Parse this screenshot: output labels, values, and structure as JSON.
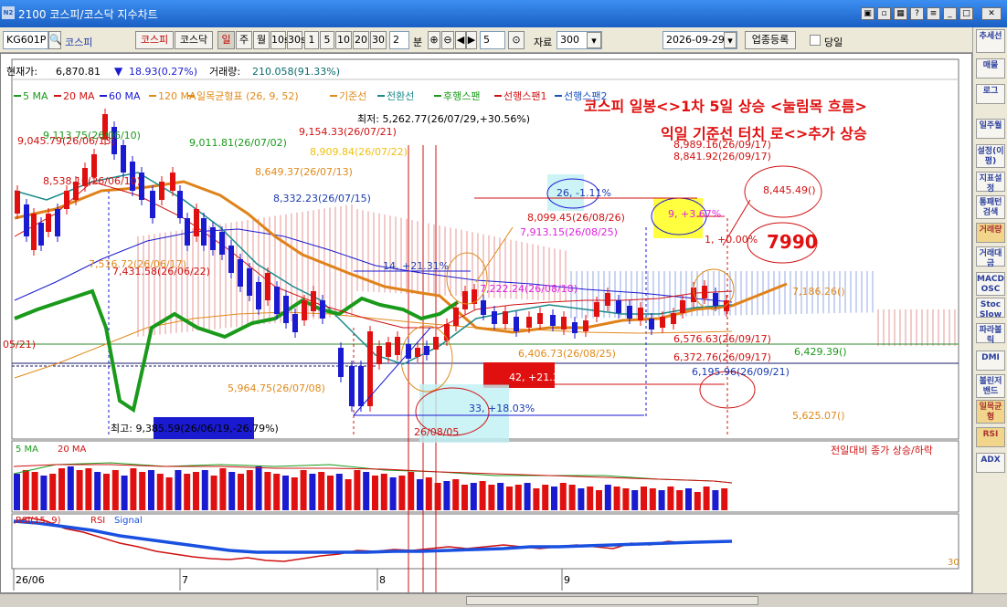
{
  "window": {
    "title": "2100 코스피/코스닥 지수차트",
    "icon_text": "N2"
  },
  "toolbar": {
    "code": "KG601P",
    "name": "코스피",
    "btn_kospi": "코스피",
    "btn_kosdaq": "코스닥",
    "periods": [
      "일",
      "주",
      "월",
      "10s",
      "30s",
      "1",
      "5",
      "10",
      "20",
      "30"
    ],
    "count_value": "2",
    "unit_label": "분",
    "span_value": "5",
    "data_label": "자료",
    "data_value": "300",
    "date_value": "2026-09-29",
    "industry_btn": "업종등록",
    "same_day_label": "당일"
  },
  "sidebar": [
    "추세선",
    "매물",
    "로그",
    "일주월",
    "설정(이평)",
    "지표설정",
    "통패턴검색",
    "거래량",
    "거래대금",
    "MACD OSC",
    "Stoc Slow",
    "파라볼릭",
    "DMI",
    "볼린저밴드",
    "일목균형",
    "RSI",
    "ADX"
  ],
  "chart": {
    "info": {
      "price_label": "현재가:",
      "price": "6,870.81",
      "change": "18.93(0.27%)",
      "vol_label": "거래량:",
      "volume": "210.058(91.33%)"
    },
    "legend": [
      {
        "label": "5 MA",
        "color": "#1a9a1a"
      },
      {
        "label": "20 MA",
        "color": "#d01010"
      },
      {
        "label": "60 MA",
        "color": "#1a1ad0"
      },
      {
        "label": "120 MA",
        "color": "#e08a1a"
      },
      {
        "label": "일목균형표 (26, 9, 52)",
        "color": "#e08a1a"
      },
      {
        "label": "기준선",
        "color": "#e08a1a"
      },
      {
        "label": "전환선",
        "color": "#1a8a8a"
      },
      {
        "label": "후행스팬",
        "color": "#1a9a1a"
      },
      {
        "label": "선행스팬1",
        "color": "#d01010"
      },
      {
        "label": "선행스팬2",
        "color": "#1a50c0"
      }
    ],
    "headline1": "코스피 일봉<>1차 5일 상승 <눌림목 흐름>",
    "headline2": "익일 기준선 터치 로<>추가 상승",
    "target": "7990",
    "annotations": [
      "9,113.75(26/06/10)",
      "9,045.79(26/06/13)",
      "8,538.10(26/06/10)",
      "9,011.81(26/07/02)",
      "9,154.33(26/07/21)",
      "최저: 5,262.77(26/07/29,+30.56%)",
      "8,909.84(26/07/22)",
      "8,649.37(26/07/13)",
      "8,332.23(26/07/15)",
      "26, -1.11%",
      "8,989.16(26/09/17)",
      "8,841.92(26/09/17)",
      "8,445.49()",
      "8,099.45(26/08/26)",
      "9, +3.67%",
      "7,913.15(26/08/25)",
      "1, +0.00%",
      "7,516.72(26/06/17)",
      "7,431.58(26/06/22)",
      "14, +21.31%",
      "7,222.24(26/08/18)",
      "7,186.26()",
      "6,576.63(26/09/17)",
      "6,429.39()",
      "6,406.73(26/08/25)",
      "6,372.76(26/09/17)",
      "05/21)",
      "6,195.96(26/09/21)",
      "42, +21.32%",
      "5,964.75(26/07/08)",
      "33, +18.03%",
      "5,625.07()",
      "최고: 9,385.59(26/06/19,-26.79%)",
      "26/08/05"
    ],
    "xaxis": [
      "26/06",
      "7",
      "8",
      "9"
    ],
    "volume_legend": [
      "5 MA",
      "20 MA"
    ],
    "volume_note": "전일대비 종가 상승/하락",
    "rsi_legend": [
      "RSI(15, 9)",
      "RSI",
      "Signal"
    ],
    "rsi_level": "30"
  }
}
